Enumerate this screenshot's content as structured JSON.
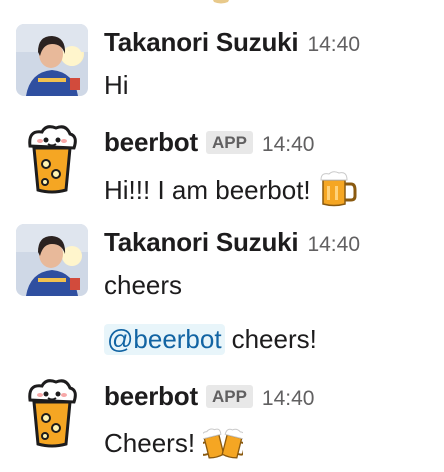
{
  "messages": [
    {
      "author": "Takanori Suzuki",
      "time": "14:40",
      "text": "Hi",
      "avatar": "user-photo"
    },
    {
      "author": "beerbot",
      "badge": "APP",
      "time": "14:40",
      "text": "Hi!!! I am beerbot!",
      "avatar": "beer-mug-bot",
      "emoji": "beer-mug-icon"
    },
    {
      "author": "Takanori Suzuki",
      "time": "14:40",
      "text": "cheers",
      "followup_mention": "@beerbot",
      "followup_text": "cheers!",
      "avatar": "user-photo"
    },
    {
      "author": "beerbot",
      "badge": "APP",
      "time": "14:40",
      "text": "Cheers!",
      "avatar": "beer-mug-bot",
      "emoji": "clinking-beer-mugs-icon"
    }
  ],
  "colors": {
    "text": "#1d1c1d",
    "muted": "#616061",
    "badge_bg": "#e8e8e8",
    "mention_bg": "#e8f5fa",
    "mention_text": "#1264a3",
    "beer": "#f5a623"
  }
}
